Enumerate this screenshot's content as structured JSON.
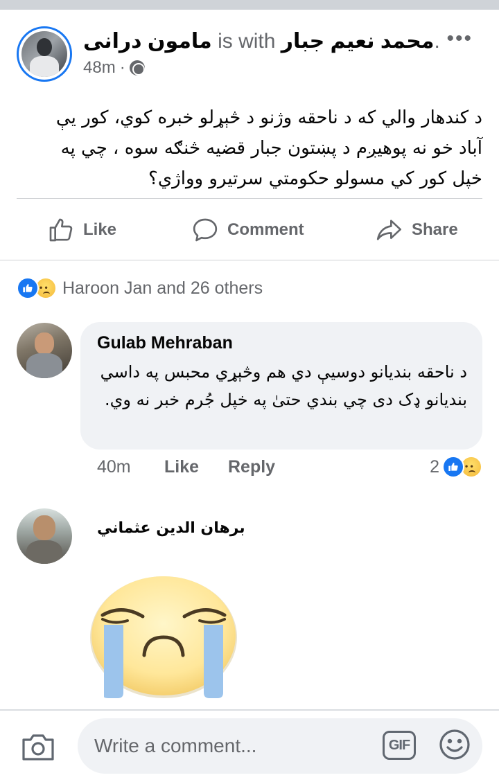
{
  "post": {
    "author": "مامون درانی",
    "connector": "is with",
    "tagged": "محمد نعیم جبار",
    "period": ".",
    "time": "48m",
    "separator": "·",
    "more": "•••",
    "text": "د کندهار والي که د ناحقه وژنو د څېړلو خبره کوي، کور يې آباد خو نه پوهیږم د پښتون جبار قضیه څنګه سوه ، چي په خپل کور کي مسولو حکومتي سرتیرو وواژي؟"
  },
  "actions": {
    "like": "Like",
    "comment": "Comment",
    "share": "Share"
  },
  "reactions": {
    "summary": "Haroon Jan and 26 others"
  },
  "comments": [
    {
      "name": "Gulab Mehraban",
      "text": "د ناحقه بندیانو دوسیې دي هم وڅېړي محبس په داسي بندیانو ډک دی چي بندي حتیٰ په خپل جُرم خبر نه وي.",
      "time": "40m",
      "like_label": "Like",
      "reply_label": "Reply",
      "reaction_count": "2"
    },
    {
      "name": "برهان الدين عثماني",
      "sticker": "crying-face-sticker"
    }
  ],
  "composer": {
    "placeholder": "Write a comment...",
    "gif_label": "GIF"
  },
  "colors": {
    "accent": "#1877f2",
    "muted_text": "#65676b",
    "bubble": "#f0f2f5"
  }
}
